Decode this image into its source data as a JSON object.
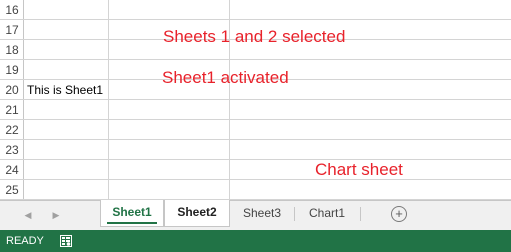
{
  "grid": {
    "rows": [
      "16",
      "17",
      "18",
      "19",
      "20",
      "21",
      "22",
      "23",
      "24",
      "25"
    ],
    "cell_a20": "This is Sheet1"
  },
  "annotations": {
    "sheets_selected": "Sheets 1 and 2 selected",
    "sheet_activated": "Sheet1 activated",
    "chart_sheet": "Chart sheet",
    "color": "#e8222b"
  },
  "tabs": [
    {
      "label": "Sheet1",
      "selected": true,
      "active": true
    },
    {
      "label": "Sheet2",
      "selected": true,
      "active": false
    },
    {
      "label": "Sheet3",
      "selected": false,
      "active": false
    },
    {
      "label": "Chart1",
      "selected": false,
      "active": false
    }
  ],
  "tab_icons": {
    "prev": "scroll-left-icon",
    "next": "scroll-right-icon",
    "add": "add-sheet-icon",
    "add_glyph": "+"
  },
  "status": {
    "mode": "READY",
    "icon": "macro-record-icon"
  },
  "colors": {
    "accent": "#217346",
    "gridline": "#d4d4d4"
  }
}
